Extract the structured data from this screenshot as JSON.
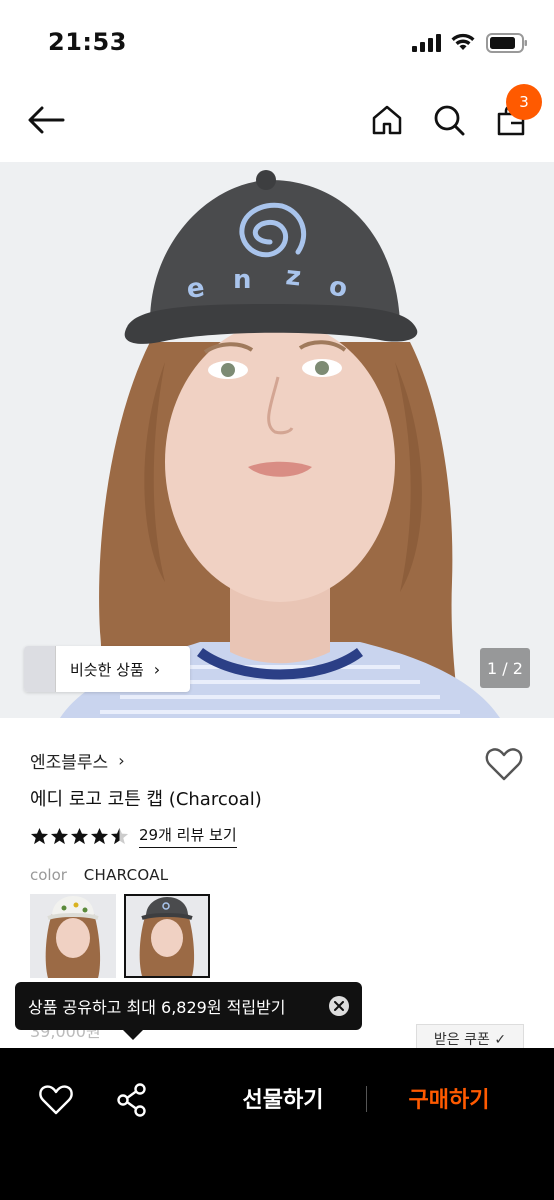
{
  "status_bar": {
    "time": "21:53"
  },
  "nav": {
    "cart_count": "3"
  },
  "gallery": {
    "similar_label": "비슷한 상품",
    "page_indicator": "1 / 2",
    "cap_text": "enzo"
  },
  "product": {
    "brand": "엔조블루스",
    "name": "에디 로고 코튼 캡 (Charcoal)",
    "rating": 4.5,
    "review_link": "29개 리뷰 보기",
    "color_label": "color",
    "color_value": "CHARCOAL",
    "price_strike": "39,000원",
    "coupon_label": "받은 쿠폰 ✓"
  },
  "tooltip": {
    "text": "상품 공유하고 최대 6,829원 적립받기"
  },
  "bottom_bar": {
    "gift_label": "선물하기",
    "buy_label": "구매하기"
  },
  "colors": {
    "accent": "#ff5a00",
    "black": "#000000",
    "cap": "#4a4b4d",
    "cap_logo": "#a9c4ec"
  }
}
